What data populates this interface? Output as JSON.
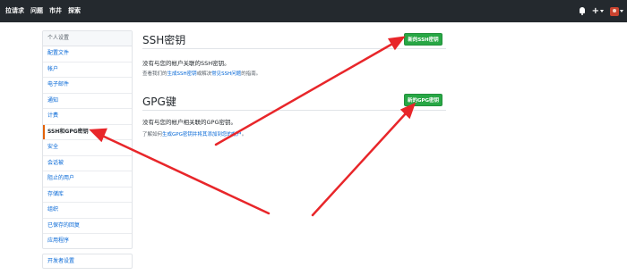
{
  "topnav": {
    "items": [
      "拉请求",
      "问题",
      "市井",
      "探索"
    ]
  },
  "sidebar": {
    "header": "个人设置",
    "items": [
      {
        "label": "配置文件"
      },
      {
        "label": "帐户"
      },
      {
        "label": "电子邮件"
      },
      {
        "label": "通知"
      },
      {
        "label": "计费"
      },
      {
        "label": "SSH和GPG密钥",
        "active": true
      },
      {
        "label": "安全"
      },
      {
        "label": "会话被"
      },
      {
        "label": "阻止的用户"
      },
      {
        "label": "存储库"
      },
      {
        "label": "组织"
      },
      {
        "label": "已保存的回复"
      },
      {
        "label": "应用程序"
      }
    ],
    "developer_settings": "开发者设置"
  },
  "ssh": {
    "title": "SSH密钥",
    "new_button": "新的SSH密钥",
    "empty_text": "没有与您的帐户关联的SSH密钥。",
    "help_prefix": "查看我们的",
    "help_link1": "生成SSH密钥",
    "help_mid": "或解决",
    "help_link2": "常见SSH问题",
    "help_suffix": "的指南。"
  },
  "gpg": {
    "title": "GPG键",
    "new_button": "新的GPG密钥",
    "empty_text": "没有与您的帐户相关联的GPG密钥。",
    "help_prefix": "了解如何",
    "help_link": "生成GPG密钥并将其添加到您的帐户",
    "help_suffix": "。"
  },
  "colors": {
    "header_bg": "#24292e",
    "button_green": "#28a745",
    "link_blue": "#0366d6",
    "active_accent": "#e36209",
    "annotation_arrow": "#e8262a"
  },
  "icons": {
    "notifications": "bell-icon",
    "create_new": "plus-icon",
    "user_menu": "avatar"
  }
}
